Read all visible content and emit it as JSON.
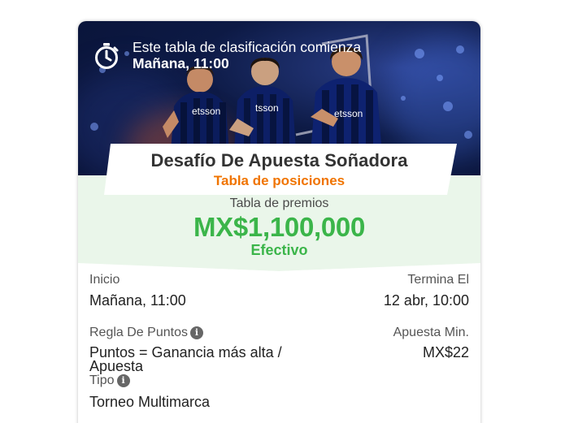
{
  "banner": {
    "line1": "Este tabla de clasificación comienza",
    "line2": "Mañana, 11:00",
    "timer_icon": "stopwatch-icon"
  },
  "header": {
    "title": "Desafío De Apuesta Soñadora",
    "subtitle": "Tabla de posiciones"
  },
  "prize": {
    "label": "Tabla de premios",
    "amount": "MX$1,100,000",
    "type": "Efectivo"
  },
  "details": {
    "start_label": "Inicio",
    "start_value": "Mañana, 11:00",
    "end_label": "Termina El",
    "end_value": "12 abr, 10:00",
    "rule_label": "Regla De Puntos",
    "rule_value": "Puntos = Ganancia más alta / Apuesta",
    "minbet_label": "Apuesta Min.",
    "minbet_value": "MX$22",
    "type_label": "Tipo",
    "type_value": "Torneo Multimarca",
    "info_icon": "info-icon"
  },
  "colors": {
    "accent_orange": "#f07400",
    "prize_green": "#3bb54a",
    "band_green": "#eaf6ea"
  }
}
